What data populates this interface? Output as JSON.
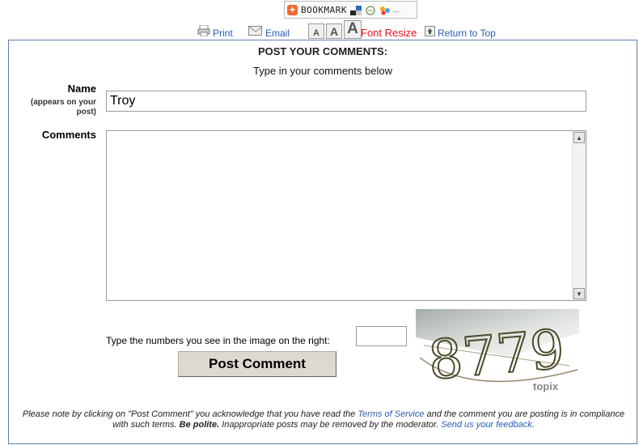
{
  "bookmark": {
    "label": "BOOKMARK",
    "more": "..."
  },
  "toolbar": {
    "print": "Print",
    "email": "Email",
    "font_small": "A",
    "font_medium": "A",
    "font_large": "A",
    "font_resize": "Font Resize",
    "return_top": "Return to Top"
  },
  "form": {
    "title": "POST YOUR COMMENTS:",
    "subtitle": "Type in your comments below",
    "name_label": "Name",
    "name_note_1": "(appears on your",
    "name_note_2": "post)",
    "name_value": "Troy",
    "comments_label": "Comments",
    "comments_value": "",
    "captcha_prompt": "Type the numbers you see in the image on the right:",
    "captcha_value": "",
    "captcha_digits": "8779",
    "captcha_brand": "topix",
    "post_button": "Post Comment"
  },
  "notice": {
    "t1": "Please note by clicking on \"Post Comment\" you acknowledge that you have read the ",
    "tos_link": "Terms of Service",
    "t2": " and the comment you are posting is in compliance with such terms. ",
    "bold": "Be polite.",
    "t3": " Inappropriate posts may be removed by the moderator. ",
    "feedback_link": "Send us your feedback",
    "t4": "."
  },
  "colors": {
    "accent_link": "#2a5db0",
    "resize_red": "#e8121c",
    "border_blue": "#5d7fb4"
  }
}
